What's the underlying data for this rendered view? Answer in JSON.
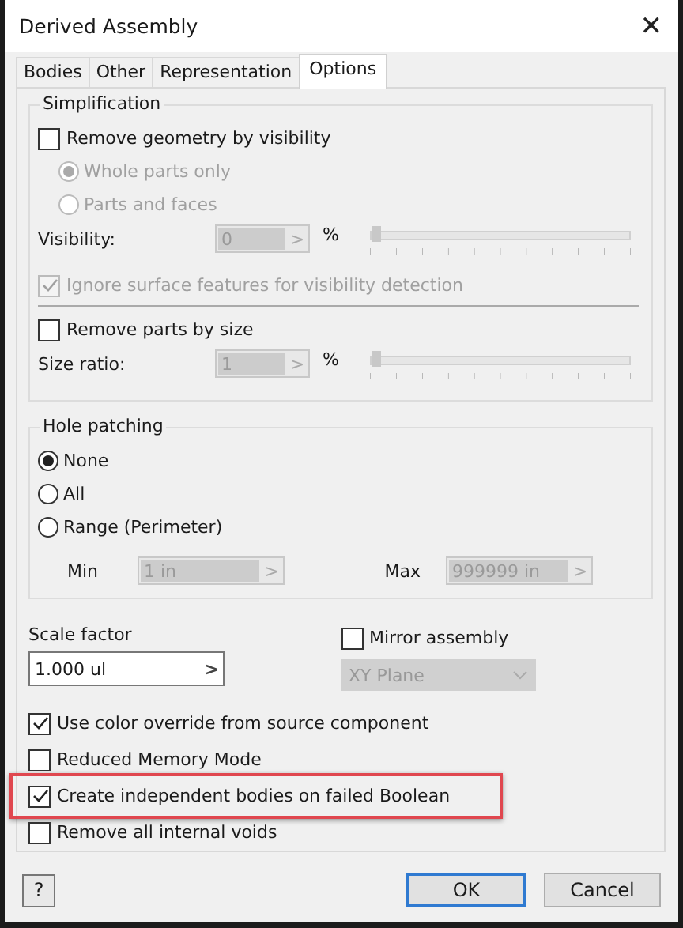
{
  "window": {
    "title": "Derived Assembly",
    "close": "✕"
  },
  "tabs": [
    {
      "label": "Bodies",
      "selected": false
    },
    {
      "label": "Other",
      "selected": false
    },
    {
      "label": "Representation",
      "selected": false
    },
    {
      "label": "Options",
      "selected": true
    }
  ],
  "simplification": {
    "title": "Simplification",
    "remove_by_visibility": {
      "label": "Remove geometry by visibility",
      "checked": false
    },
    "radios": [
      {
        "label": "Whole parts only",
        "selected": true,
        "disabled": true
      },
      {
        "label": "Parts and faces",
        "selected": false,
        "disabled": true
      }
    ],
    "visibility": {
      "label": "Visibility:",
      "value": "0",
      "arrow": ">",
      "unit": "%",
      "level": 0,
      "disabled": true
    },
    "ignore_surface": {
      "label": "Ignore surface features for visibility detection",
      "checked": true,
      "disabled": true
    },
    "remove_by_size": {
      "label": "Remove parts by size",
      "checked": false
    },
    "size_ratio": {
      "label": "Size ratio:",
      "value": "1",
      "arrow": ">",
      "unit": "%",
      "level": 0,
      "disabled": true
    }
  },
  "hole_patching": {
    "title": "Hole patching",
    "options": [
      {
        "label": "None",
        "selected": true
      },
      {
        "label": "All",
        "selected": false
      },
      {
        "label": "Range (Perimeter)",
        "selected": false
      }
    ],
    "min": {
      "label": "Min",
      "value": "1 in",
      "arrow": ">",
      "disabled": true
    },
    "max": {
      "label": "Max",
      "value": "999999 in",
      "arrow": ">",
      "disabled": true
    }
  },
  "scale_factor": {
    "label": "Scale factor",
    "value": "1.000 ul",
    "arrow": ">"
  },
  "mirror": {
    "label": "Mirror assembly",
    "checked": false
  },
  "plane": {
    "value": "XY Plane",
    "disabled": true
  },
  "options": [
    {
      "label": "Use color override from source component",
      "checked": true,
      "highlighted": false
    },
    {
      "label": "Reduced Memory Mode",
      "checked": false,
      "highlighted": false
    },
    {
      "label": "Create independent bodies on failed Boolean",
      "checked": true,
      "highlighted": true
    },
    {
      "label": "Remove all internal voids",
      "checked": false,
      "highlighted": false
    }
  ],
  "help": {
    "label": "?"
  },
  "buttons": [
    {
      "label": "OK",
      "default": true
    },
    {
      "label": "Cancel",
      "default": false
    }
  ]
}
